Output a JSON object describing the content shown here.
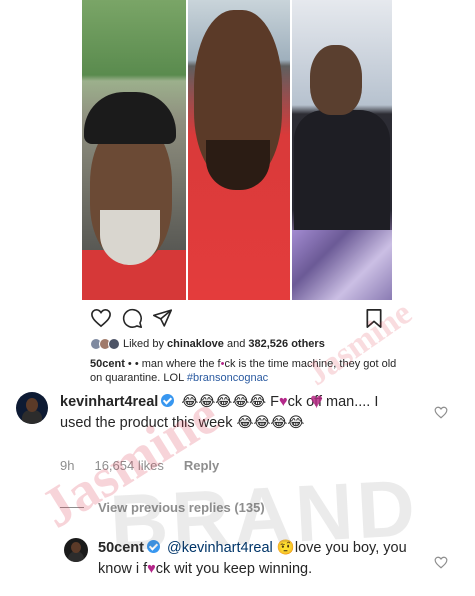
{
  "post": {
    "liked_by_prefix": "Liked by",
    "liked_by_user": "chinaklove",
    "liked_by_and": "and",
    "likes_count": "382,526 others",
    "caption_user": "50cent",
    "caption_text": " • • man where the f",
    "caption_text2": "ck is the time machine, they got old on quarantine. LOL ",
    "caption_hashtag": "#bransoncognac"
  },
  "comment1": {
    "username": "kevinhart4real",
    "emojis_a": "😂😂😂😂😂",
    "text_a": " F",
    "text_b": "ck off man.... I used the product this week ",
    "emojis_b": "😂😂😂😂",
    "time": "9h",
    "likes": "16,654 likes",
    "reply_label": "Reply"
  },
  "replies": {
    "view_label": "View previous replies (135)"
  },
  "comment2": {
    "username": "50cent",
    "mention": "@kevinhart4real",
    "emoji": "🤨",
    "text_a": "love you boy, you know i f",
    "text_b": "ck wit you keep winning."
  },
  "watermark": {
    "line1": "Jasmine",
    "line2": "Jasmine",
    "line3": "BRAND"
  },
  "icons": {
    "like": "heart-icon",
    "comment": "comment-icon",
    "share": "share-icon",
    "save": "bookmark-icon"
  },
  "colors": {
    "link": "#003569",
    "verified": "#3897f0",
    "muted": "#8e8e8e"
  }
}
